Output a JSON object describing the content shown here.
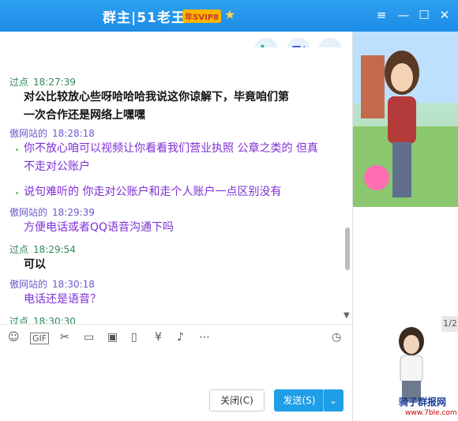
{
  "window": {
    "title": "群主|51老王",
    "vip_badge": "年SVIP8"
  },
  "messages": [
    {
      "sender": "过点",
      "time": "18:27:39",
      "lines": [
        "对公比较放心些呀哈哈哈我说这你谅解下，毕竟咱们第",
        "一次合作还是网络上嘿嘿"
      ]
    },
    {
      "sender": "傲网站的",
      "time": "18:28:18",
      "lines": [
        "你不放心咱可以视频让你看看我们营业执照   公章之类的   但真",
        "不走对公账户"
      ]
    },
    {
      "sender": "",
      "time": "",
      "lines": [
        "说句难听的   你走对公账户和走个人账户一点区别没有"
      ]
    },
    {
      "sender": "傲网站的",
      "time": "18:29:39",
      "lines": [
        "方便电话或者QQ语音沟通下吗"
      ]
    },
    {
      "sender": "过点",
      "time": "18:29:54",
      "lines": [
        "可以"
      ]
    },
    {
      "sender": "傲网站的",
      "time": "18:30:18",
      "lines": [
        "电话还是语音？"
      ]
    },
    {
      "sender": "过点",
      "time": "18:30:30",
      "lines": []
    }
  ],
  "buttons": {
    "close": "关闭(C)",
    "send": "发送(S)"
  },
  "sidebar": {
    "pager": "1/2",
    "watermark": "骑子群报网",
    "watermark_url": "www.7ble.com"
  },
  "colors": {
    "titlebar": "#1c8ce6",
    "send_button": "#1e9ee6",
    "other_message": "#7e2fd4"
  }
}
